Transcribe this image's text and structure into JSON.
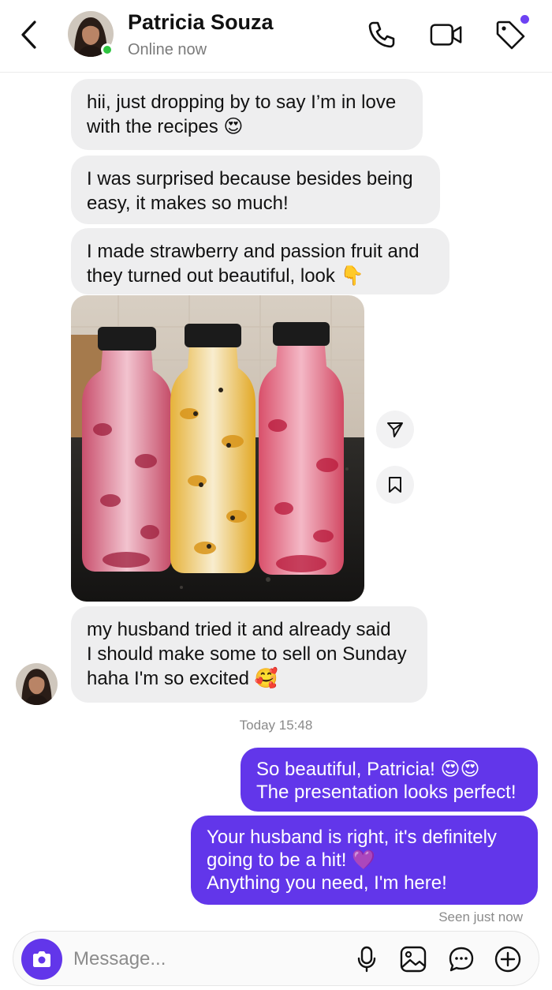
{
  "contact": {
    "name": "Patricia Souza",
    "status": "Online now"
  },
  "colors": {
    "accent": "#6236ea",
    "online": "#2ec440",
    "incoming_bubble": "#eeeeef"
  },
  "header_icons": [
    "back-chevron-icon",
    "phone-icon",
    "video-camera-icon",
    "tag-icon"
  ],
  "messages_in": [
    {
      "lines": [
        "hii, just dropping by to say I’m in love",
        "with the recipes 😍"
      ]
    },
    {
      "lines": [
        "I was surprised because besides being",
        "easy, it makes so much!"
      ]
    },
    {
      "lines": [
        "I made strawberry and passion fruit and",
        "they turned out beautiful, look 👇"
      ]
    },
    {
      "lines": [
        "my husband tried it and already said",
        "I should make some to sell on Sunday",
        "haha I'm so excited 🥰"
      ]
    }
  ],
  "photo": {
    "subject": "three smoothie bottles - strawberry, passion fruit, strawberry",
    "actions": [
      "share-icon",
      "save-bookmark-icon"
    ]
  },
  "timestamp": "Today 15:48",
  "messages_out": [
    {
      "lines": [
        "So beautiful, Patricia! 😍😍",
        "The presentation looks perfect!"
      ]
    },
    {
      "lines": [
        "Your husband is right, it's definitely",
        "going to be a hit! 💜",
        "Anything you need, I'm here!"
      ]
    }
  ],
  "seen": "Seen just now",
  "composer": {
    "placeholder": "Message...",
    "icons": [
      "camera-icon",
      "microphone-icon",
      "image-gallery-icon",
      "sticker-chat-icon",
      "add-icon"
    ]
  }
}
